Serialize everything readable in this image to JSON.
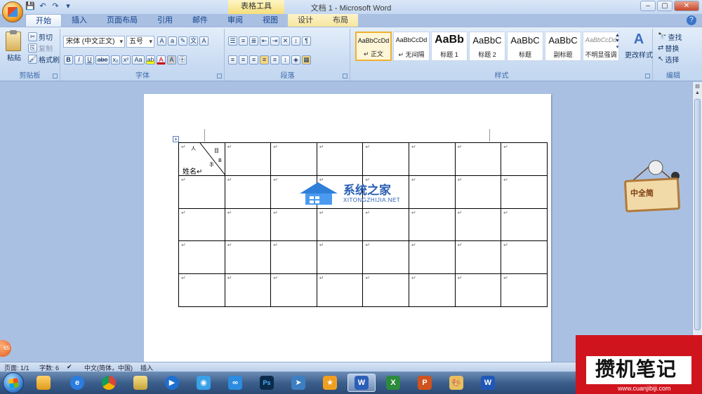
{
  "window": {
    "title": "文档 1 - Microsoft Word",
    "context_tab_title": "表格工具"
  },
  "tabs": [
    "开始",
    "插入",
    "页面布局",
    "引用",
    "邮件",
    "审阅",
    "视图",
    "设计",
    "布局"
  ],
  "clipboard": {
    "paste": "粘贴",
    "cut": "剪切",
    "copy": "复制",
    "format_painter": "格式刷",
    "label": "剪贴板"
  },
  "font": {
    "name": "宋体 (中文正文)",
    "size": "五号",
    "label": "字体",
    "buttons": [
      "B",
      "I",
      "U",
      "abe",
      "x₂",
      "x²",
      "Aa"
    ]
  },
  "paragraph": {
    "label": "段落"
  },
  "styles": {
    "label": "样式",
    "items": [
      {
        "sample": "AaBbCcDd",
        "name": "↵ 正文"
      },
      {
        "sample": "AaBbCcDd",
        "name": "↵ 无间隔"
      },
      {
        "sample": "AaBb",
        "name": "标题 1"
      },
      {
        "sample": "AaBbC",
        "name": "标题 2"
      },
      {
        "sample": "AaBbC",
        "name": "标题"
      },
      {
        "sample": "AaBbC",
        "name": "副标题"
      },
      {
        "sample": "AaBbCcDd",
        "name": "不明显强调"
      }
    ],
    "change": "更改样式"
  },
  "editing": {
    "label": "编辑",
    "find": "查找",
    "replace": "替换",
    "select": "选择"
  },
  "table": {
    "header_cell": {
      "top_left": "↵",
      "top_mid": "人",
      "right_top": "目",
      "mid": "手",
      "right_mid": "B",
      "bottom": "姓名↵"
    },
    "rows": 5,
    "cols": 8,
    "cell_mark": "↵"
  },
  "watermark": {
    "title": "系统之家",
    "url": "XITONGZHIJIA.NET",
    "sticker": "中全简"
  },
  "status": {
    "page": "页面: 1/1",
    "words": "字数: 6",
    "lang": "中文(简体，中国)",
    "mode": "插入"
  },
  "corner_watermark": {
    "text": "攒机笔记",
    "url": "www.cuanjibiji.com"
  },
  "taskbar": {
    "items": [
      "folder",
      "ie",
      "chrome",
      "explorer",
      "media",
      "qq",
      "baidu",
      "ps",
      "bird",
      "star",
      "word",
      "excel",
      "ppt",
      "paint",
      "wps"
    ]
  },
  "colors": {
    "ribbon": "#c9dbf2",
    "doc_bg": "#a9c0e3",
    "accent": "#15428b"
  }
}
